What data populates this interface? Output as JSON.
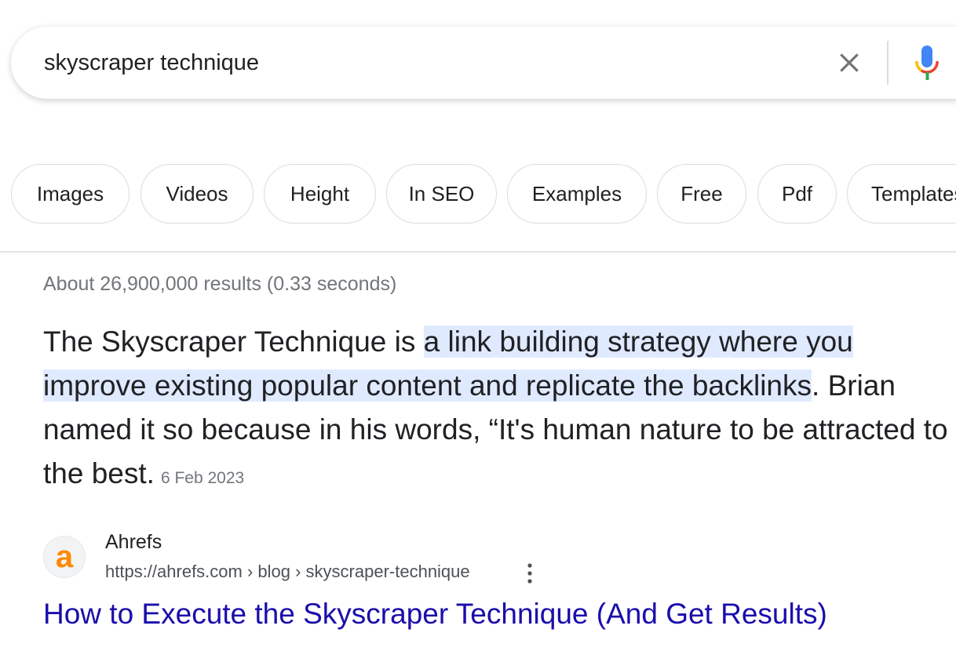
{
  "search": {
    "query": "skyscraper technique",
    "clear_icon": "close-icon",
    "mic_icon": "microphone-icon"
  },
  "chips": [
    "Images",
    "Videos",
    "Height",
    "In SEO",
    "Examples",
    "Free",
    "Pdf",
    "Templates"
  ],
  "result_stats": "About 26,900,000 results (0.33 seconds)",
  "snippet": {
    "before": "The Skyscraper Technique is ",
    "highlight": "a link building strategy where you improve existing popular content and replicate the backlinks",
    "after": ". Brian named it so because in his words, “It's human nature to be attracted to the best.",
    "date": "6 Feb 2023",
    "highlight_color": "#e0eaff"
  },
  "result": {
    "site_name": "Ahrefs",
    "favicon_letter": "a",
    "url": "https://ahrefs.com › blog › skyscraper-technique",
    "title": "How to Execute the Skyscraper Technique (And Get Results)",
    "link_color": "#1a0dab",
    "more_icon": "more-vert-icon"
  }
}
